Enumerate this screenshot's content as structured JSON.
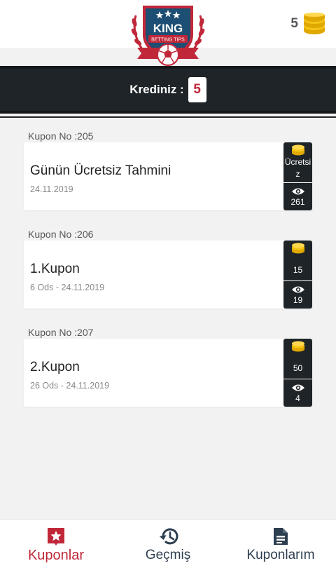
{
  "header": {
    "logo_text": "KING",
    "logo_sub": "BETTING TIPS",
    "coins": "5"
  },
  "credit": {
    "label": "Krediniz :",
    "value": "5"
  },
  "coupons": [
    {
      "number_label": "Kupon No :205",
      "title": "Günün Ücretsiz Tahmini",
      "subtitle": "24.11.2019",
      "price": "Ücretsiz",
      "views": "261"
    },
    {
      "number_label": "Kupon No :206",
      "title": "1.Kupon",
      "subtitle": "6 Ods - 24.11.2019",
      "price": "15",
      "views": "19"
    },
    {
      "number_label": "Kupon No :207",
      "title": "2.Kupon",
      "subtitle": "26 Ods - 24.11.2019",
      "price": "50",
      "views": "4"
    }
  ],
  "nav": [
    {
      "label": "Kuponlar",
      "icon": "ticket-star-icon",
      "active": true
    },
    {
      "label": "Geçmiş",
      "icon": "history-icon",
      "active": false
    },
    {
      "label": "Kuponlarım",
      "icon": "document-icon",
      "active": false
    }
  ],
  "colors": {
    "accent": "#c0283a",
    "dark": "#1f2428",
    "coin": "#f5c518",
    "nav_text": "#2d3e50"
  }
}
